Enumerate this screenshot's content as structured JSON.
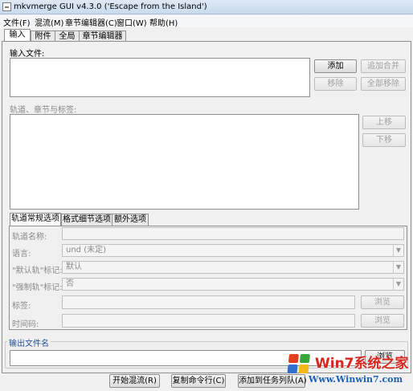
{
  "window": {
    "title": "mkvmerge GUI v4.3.0 ('Escape from the Island')"
  },
  "menu": [
    {
      "label": "文件(F)"
    },
    {
      "label": "混流(M)"
    },
    {
      "label": "章节编辑器(C)"
    },
    {
      "label": "窗口(W)"
    },
    {
      "label": "帮助(H)"
    }
  ],
  "tabs": [
    {
      "label": "输入",
      "active": true
    },
    {
      "label": "附件"
    },
    {
      "label": "全局"
    },
    {
      "label": "章节编辑器"
    }
  ],
  "input": {
    "files_label": "输入文件:",
    "add_button": "添加",
    "append_button": "追加合并",
    "remove_button": "移除",
    "remove_all_button": "全部移除",
    "tracks_label": "轨道、章节与标签:",
    "up_button": "上移",
    "down_button": "下移"
  },
  "subtabs": [
    {
      "label": "轨道常规选项",
      "active": true
    },
    {
      "label": "格式细节选项"
    },
    {
      "label": "额外选项"
    }
  ],
  "track_options": {
    "track_name_label": "轨道名称:",
    "language_label": "语言:",
    "language_value": "und (未定)",
    "default_track_label": "\"默认轨\"标记:",
    "default_track_value": "默认",
    "forced_track_label": "\"强制轨\"标记:",
    "forced_track_value": "否",
    "tags_label": "标签:",
    "tags_browse": "浏览",
    "timecodes_label": "时间码:",
    "timecodes_browse": "浏览"
  },
  "output": {
    "group_label": "输出文件名",
    "browse_button": "浏览"
  },
  "bottom_buttons": {
    "start_mux": "开始混流(R)",
    "copy_cmd": "复制命令行(C)",
    "add_to_queue": "添加到任务列队(A)"
  },
  "watermark": {
    "brand": "Win7系统之家",
    "url": "Www.Winwin7.com"
  },
  "colors": {
    "group_label": "#1f4e99",
    "disabled_text": "#8a8a8a",
    "watermark_red": "#d7261e",
    "watermark_blue": "#1a5fb4"
  }
}
